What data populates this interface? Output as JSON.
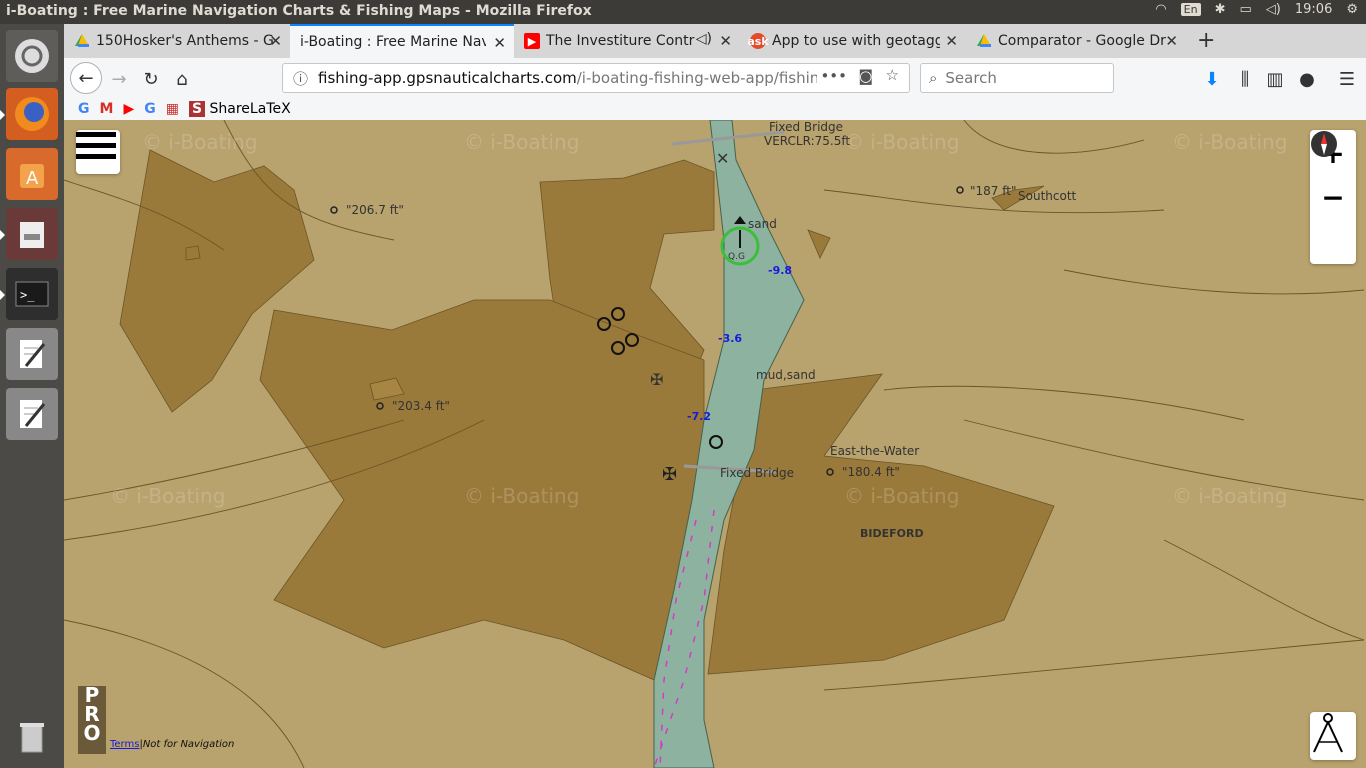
{
  "window": {
    "title": "i-Boating : Free Marine Navigation Charts & Fishing Maps - Mozilla Firefox"
  },
  "tray": {
    "keyboard": "En",
    "time": "19:06"
  },
  "tabs": [
    {
      "title": "150Hosker's Anthems - G",
      "icon": "google-drive-icon"
    },
    {
      "title": "i-Boating : Free Marine Navi",
      "icon": "none",
      "active": true
    },
    {
      "title": "The Investiture Contr",
      "icon": "youtube-icon"
    },
    {
      "title": "App to use with geotagg",
      "icon": "ask-icon"
    },
    {
      "title": "Comparator - Google Dr",
      "icon": "google-drive-icon"
    }
  ],
  "url": {
    "host": "fishing-app.gpsnauticalcharts.com",
    "path": "/i-boating-fishing-web-app/fishing"
  },
  "search": {
    "placeholder": "Search"
  },
  "bookmarks": {
    "sharelatex": "ShareLaTeX"
  },
  "map": {
    "labels": {
      "fixed_bridge_top": "Fixed Bridge",
      "verclr": "VERCLR:75.5ft",
      "sand": "sand",
      "og": "Q.G",
      "mud_sand": "mud,sand",
      "fixed_bridge": "Fixed Bridge",
      "east_the_water": "East-the-Water",
      "bideford": "BIDEFORD",
      "southcott": "Southcott",
      "h1": "\"206.7 ft\"",
      "h2": "\"203.4 ft\"",
      "h3": "\"187 ft\"",
      "h4": "\"180.4 ft\""
    },
    "depths": {
      "d1": "-9.8",
      "d2": "-3.6",
      "d3": "-7.2"
    },
    "watermark": "© i-Boating",
    "pro": "PRO",
    "terms": "Terms",
    "not_nav": "|Not for Navigation"
  }
}
